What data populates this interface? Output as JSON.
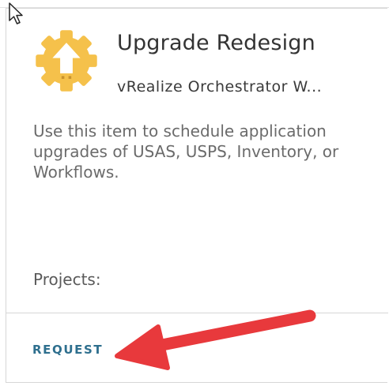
{
  "card": {
    "title": "Upgrade Redesign",
    "subtitle": "vRealize Orchestrator W...",
    "description": " Use this item to schedule application upgrades of USAS, USPS, Inventory, or Workflows.",
    "projects_label": "Projects:",
    "request_label": "REQUEST",
    "icon": "upgrade-gear-icon",
    "icon_color": "#f5c14b",
    "accent_color": "#2e6f8e"
  },
  "annotation": {
    "arrow_color": "#e8393c",
    "arrow_target": "request-button"
  },
  "cursor": {
    "icon": "mouse-pointer-icon"
  }
}
